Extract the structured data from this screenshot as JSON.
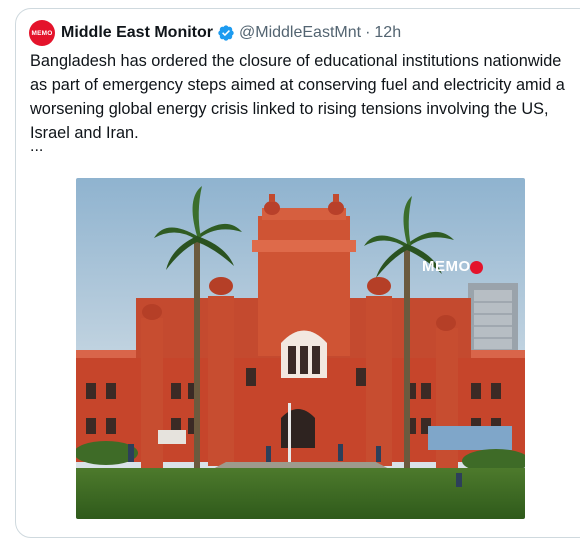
{
  "tweet": {
    "avatar_text": "MEMO",
    "display_name": "Middle East Monitor",
    "handle": "@MiddleEastMnt",
    "separator": "·",
    "time": "12h",
    "text": "Bangladesh has ordered the closure of educational institutions nationwide as part of emergency steps aimed at conserving fuel and electricity amid a worsening global energy crisis linked to rising tensions involving the US, Israel and Iran.",
    "ellipsis": "...",
    "media": {
      "watermark": "MEMO"
    }
  },
  "colors": {
    "brand_red": "#e4132b",
    "verified_blue": "#1d9bf0",
    "text_primary": "#0f1419",
    "text_secondary": "#536471"
  }
}
